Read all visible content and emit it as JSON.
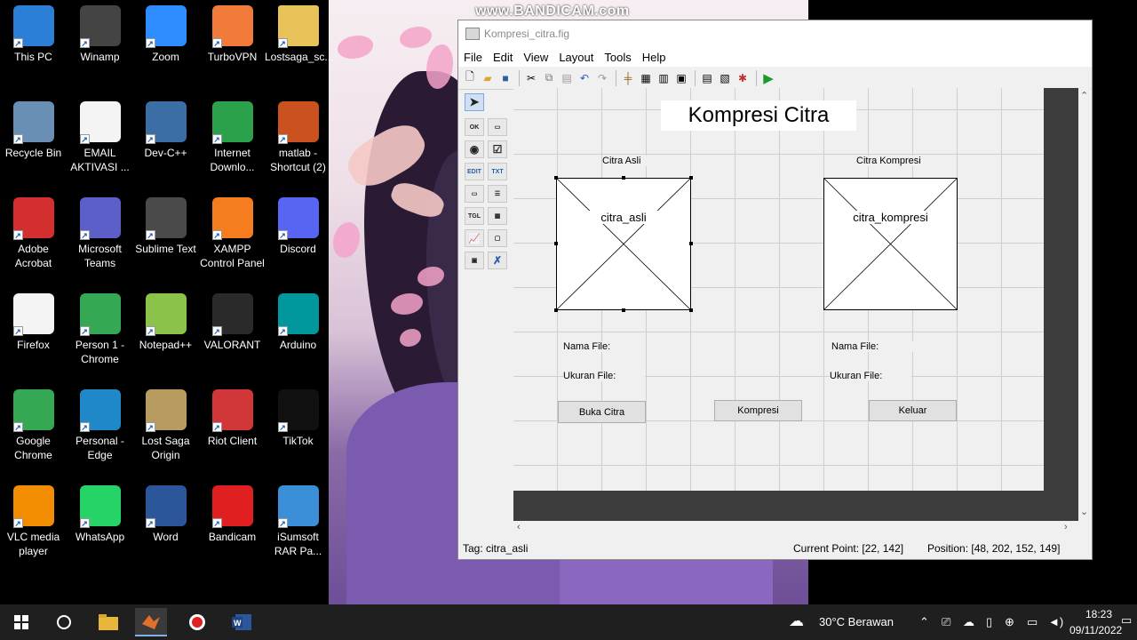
{
  "watermark": "www.BANDICAM.com",
  "desktop_icons": [
    {
      "label": "This PC",
      "icon": "monitor-icon",
      "color": "#2b7fd6"
    },
    {
      "label": "Winamp",
      "icon": "winamp-icon",
      "color": "#444444"
    },
    {
      "label": "Zoom",
      "icon": "zoom-icon",
      "color": "#2d8cff"
    },
    {
      "label": "TurboVPN",
      "icon": "turbovpn-icon",
      "color": "#f07b3b"
    },
    {
      "label": "Lostsaga_sc...",
      "icon": "folder-icon",
      "color": "#e8c35a"
    },
    {
      "label": "Recycle Bin",
      "icon": "recycle-bin-icon",
      "color": "#6a8fb5"
    },
    {
      "label": "EMAIL AKTIVASI ...",
      "icon": "document-icon",
      "color": "#eeeeee"
    },
    {
      "label": "Dev-C++",
      "icon": "devcpp-icon",
      "color": "#3a6ea5"
    },
    {
      "label": "Internet Downlo...",
      "icon": "idm-icon",
      "color": "#2aa14a"
    },
    {
      "label": "matlab - Shortcut (2)",
      "icon": "matlab-icon",
      "color": "#c9521e"
    },
    {
      "label": "Adobe Acrobat",
      "icon": "acrobat-icon",
      "color": "#d32f2f"
    },
    {
      "label": "Microsoft Teams",
      "icon": "teams-icon",
      "color": "#5b5fc7"
    },
    {
      "label": "Sublime Text",
      "icon": "sublime-icon",
      "color": "#4a4a4a"
    },
    {
      "label": "XAMPP Control Panel",
      "icon": "xampp-icon",
      "color": "#f57c1f"
    },
    {
      "label": "Discord",
      "icon": "discord-icon",
      "color": "#5865f2"
    },
    {
      "label": "Firefox",
      "icon": "document-icon",
      "color": "#eeeeee"
    },
    {
      "label": "Person 1 - Chrome",
      "icon": "chrome-icon",
      "color": "#34a853"
    },
    {
      "label": "Notepad++",
      "icon": "notepadpp-icon",
      "color": "#8bc34a"
    },
    {
      "label": "VALORANT",
      "icon": "valorant-icon",
      "color": "#2a2a2a"
    },
    {
      "label": "Arduino",
      "icon": "arduino-icon",
      "color": "#00979d"
    },
    {
      "label": "Google Chrome",
      "icon": "chrome-icon",
      "color": "#34a853"
    },
    {
      "label": "Personal - Edge",
      "icon": "edge-icon",
      "color": "#1e88c8"
    },
    {
      "label": "Lost Saga Origin",
      "icon": "lostsaga-icon",
      "color": "#b89b5e"
    },
    {
      "label": "Riot Client",
      "icon": "riot-icon",
      "color": "#d13639"
    },
    {
      "label": "TikTok",
      "icon": "tiktok-icon",
      "color": "#111111"
    },
    {
      "label": "VLC media player",
      "icon": "vlc-icon",
      "color": "#f28c00"
    },
    {
      "label": "WhatsApp",
      "icon": "whatsapp-icon",
      "color": "#25d366"
    },
    {
      "label": "Word",
      "icon": "word-icon",
      "color": "#2b579a"
    },
    {
      "label": "Bandicam",
      "icon": "bandicam-icon",
      "color": "#e02020"
    },
    {
      "label": "iSumsoft RAR Pa...",
      "icon": "isumsoft-icon",
      "color": "#3b8ed8"
    }
  ],
  "guide": {
    "title": "Kompresi_citra.fig",
    "menu": [
      "File",
      "Edit",
      "View",
      "Layout",
      "Tools",
      "Help"
    ],
    "toolbar": [
      "new-file-icon",
      "open-folder-icon",
      "save-icon",
      "cut-icon",
      "copy-icon",
      "paste-icon",
      "undo-icon",
      "redo-icon",
      "align-icon",
      "menu-editor-icon",
      "tab-order-icon",
      "toolbar-editor-icon",
      "mfile-editor-icon",
      "property-inspector-icon",
      "object-browser-icon",
      "run-icon"
    ],
    "palette": [
      "select-arrow",
      "OK",
      "slider",
      "radio",
      "check",
      "EDIT",
      "TXT",
      "popup",
      "listbox",
      "TGL",
      "table",
      "axes",
      "panel",
      "button-group",
      "activex"
    ],
    "heading": "Kompresi Citra",
    "label_asli": "Citra Asli",
    "label_kompresi": "Citra Kompresi",
    "axes_asli": "citra_asli",
    "axes_kompresi": "citra_kompresi",
    "nama_file_1": "Nama File:",
    "ukuran_file_1": "Ukuran File:",
    "nama_file_2": "Nama File:",
    "ukuran_file_2": "Ukuran File:",
    "btn_buka": "Buka Citra",
    "btn_kompresi": "Kompresi",
    "btn_keluar": "Keluar",
    "status_tag": "Tag: citra_asli",
    "status_point": "Current Point:  [22, 142]",
    "status_position": "Position: [48, 202, 152, 149]"
  },
  "taskbar": {
    "weather": "30°C  Berawan",
    "time": "18:23",
    "date": "09/11/2022",
    "apps": [
      "windows-start-icon",
      "search-circle-icon",
      "file-explorer-icon",
      "matlab-icon",
      "bandicam-icon",
      "word-icon"
    ]
  }
}
